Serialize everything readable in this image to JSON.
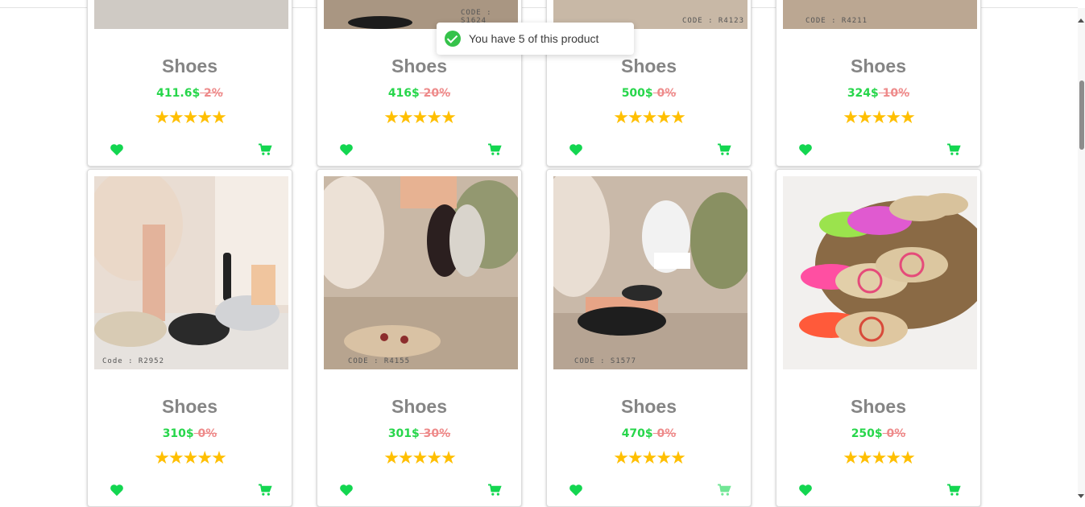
{
  "toast": {
    "message": "You have 5 of this product",
    "icon": "check-circle-icon"
  },
  "colors": {
    "price": "#27d64b",
    "discount": "#ee8a8a",
    "star": "#ffbf00",
    "title": "#858585",
    "action_green": "#13d650"
  },
  "products": [
    {
      "title": "Shoes",
      "price": "411.6$",
      "discount": " 2%",
      "stars": "★★★★★",
      "code": ""
    },
    {
      "title": "Shoes",
      "price": "416$",
      "discount": " 20%",
      "stars": "★★★★★",
      "code": "CODE : S1624"
    },
    {
      "title": "Shoes",
      "price": "500$",
      "discount": " 0%",
      "stars": "★★★★★",
      "code": "CODE : R4123"
    },
    {
      "title": "Shoes",
      "price": "324$",
      "discount": " 10%",
      "stars": "★★★★★",
      "code": "CODE : R4211"
    },
    {
      "title": "Shoes",
      "price": "310$",
      "discount": " 0%",
      "stars": "★★★★★",
      "code": "Code : R2952"
    },
    {
      "title": "Shoes",
      "price": "301$",
      "discount": " 30%",
      "stars": "★★★★★",
      "code": "CODE : R4155"
    },
    {
      "title": "Shoes",
      "price": "470$",
      "discount": " 0%",
      "stars": "★★★★★",
      "code": "CODE : S1577"
    },
    {
      "title": "Shoes",
      "price": "250$",
      "discount": " 0%",
      "stars": "★★★★★",
      "code": ""
    }
  ],
  "icons": {
    "favorite": "heart-icon",
    "cart": "cart-icon"
  }
}
